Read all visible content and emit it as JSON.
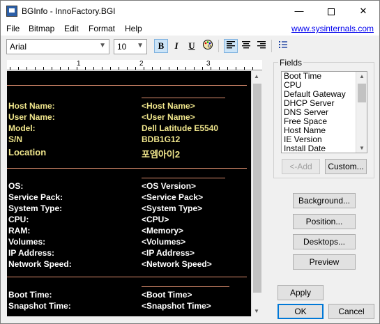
{
  "window": {
    "title": "BGInfo - InnoFactory.BGI",
    "minimize": "—",
    "close": "✕"
  },
  "menu": {
    "items": [
      "File",
      "Bitmap",
      "Edit",
      "Format",
      "Help"
    ],
    "link": "www.sysinternals.com"
  },
  "toolbar": {
    "font": "Arial",
    "size": "10",
    "bold": "B",
    "italic": "I",
    "underline": "U",
    "color": "🎨"
  },
  "ruler": {
    "labels": [
      "1",
      "2",
      "3"
    ]
  },
  "editor": {
    "section1": [
      {
        "label": "Host Name:",
        "value": "<Host Name>"
      },
      {
        "label": "User Name:",
        "value": "<User Name>"
      },
      {
        "label": "Model:",
        "value": "Dell Latitude E5540"
      },
      {
        "label": "S/N",
        "value": "BDB1G12"
      },
      {
        "label": "Location",
        "value": "포엠아이2"
      }
    ],
    "section2": [
      {
        "label": "OS:",
        "value": "<OS Version>"
      },
      {
        "label": "Service Pack:",
        "value": "<Service Pack>"
      },
      {
        "label": "System Type:",
        "value": "<System Type>"
      },
      {
        "label": "CPU:",
        "value": "<CPU>"
      },
      {
        "label": "RAM:",
        "value": "<Memory>"
      },
      {
        "label": "Volumes:",
        "value": "<Volumes>"
      },
      {
        "label": "IP Address:",
        "value": "<IP Address>"
      },
      {
        "label": "Network Speed:",
        "value": "<Network Speed>"
      }
    ],
    "section3": [
      {
        "label": "Boot Time:",
        "value": "<Boot Time>"
      },
      {
        "label": "Snapshot Time:",
        "value": "<Snapshot Time>"
      }
    ]
  },
  "fields": {
    "caption": "Fields",
    "items": [
      "Boot Time",
      "CPU",
      "Default Gateway",
      "DHCP Server",
      "DNS Server",
      "Free Space",
      "Host Name",
      "IE Version",
      "Install Date"
    ],
    "add_label": "<-Add",
    "custom_label": "Custom..."
  },
  "buttons": {
    "background": "Background...",
    "position": "Position...",
    "desktops": "Desktops...",
    "preview": "Preview",
    "apply": "Apply",
    "ok": "OK",
    "cancel": "Cancel"
  }
}
